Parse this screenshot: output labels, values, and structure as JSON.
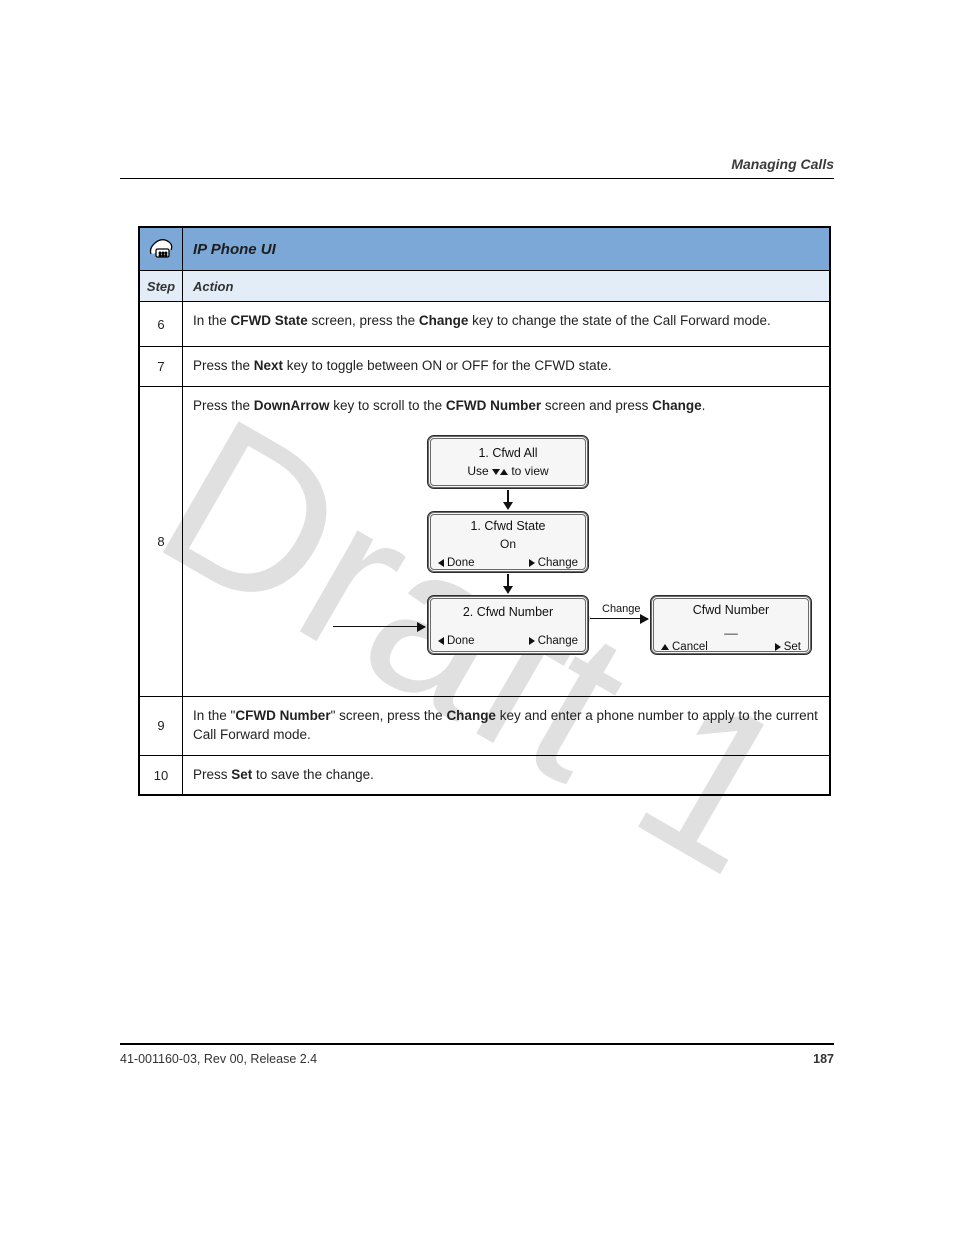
{
  "header": {
    "section_title": "Managing Calls"
  },
  "footer": {
    "doc_id": "41-001160-03, Rev 00, Release 2.4",
    "page": "187"
  },
  "watermark": "Draft 1",
  "table": {
    "title": "IP Phone UI",
    "columns": {
      "step": "Step",
      "action": "Action"
    },
    "rows": [
      {
        "step": "6",
        "action_parts": [
          "In the ",
          "CFWD State",
          " screen, press the ",
          "Change",
          " key to change the state of the Call Forward mode."
        ]
      },
      {
        "step": "7",
        "action_parts": [
          "Press the ",
          "Next",
          " key to toggle between ON or OFF for the CFWD state."
        ]
      },
      {
        "step": "8",
        "action_pre_parts": [
          "Press the ",
          "DownArrow",
          " key to scroll to the ",
          "CFWD Number",
          " screen and press ",
          "Change",
          "."
        ],
        "flow": {
          "box1": {
            "line1": "1. Cfwd All",
            "line2_pre": "Use ",
            "line2_post": " to view"
          },
          "box2": {
            "line1": "1. Cfwd State",
            "line2": "On",
            "btn_left": "Done",
            "btn_right": "Change"
          },
          "box3": {
            "line1": "2. Cfwd Number",
            "btn_left": "Done",
            "btn_right": "Change"
          },
          "box4": {
            "line1": "Cfwd Number",
            "line2": "__",
            "btn_left": "Cancel",
            "btn_right": "Set"
          },
          "edge_label": "Change"
        }
      },
      {
        "step": "9",
        "action_parts": [
          "In the \"",
          "CFWD Number",
          "\" screen, press the ",
          "Change",
          " key and enter a phone number to apply to the current Call Forward mode."
        ]
      },
      {
        "step": "10",
        "action_parts": [
          "Press ",
          "Set",
          " to save the change."
        ]
      }
    ]
  }
}
